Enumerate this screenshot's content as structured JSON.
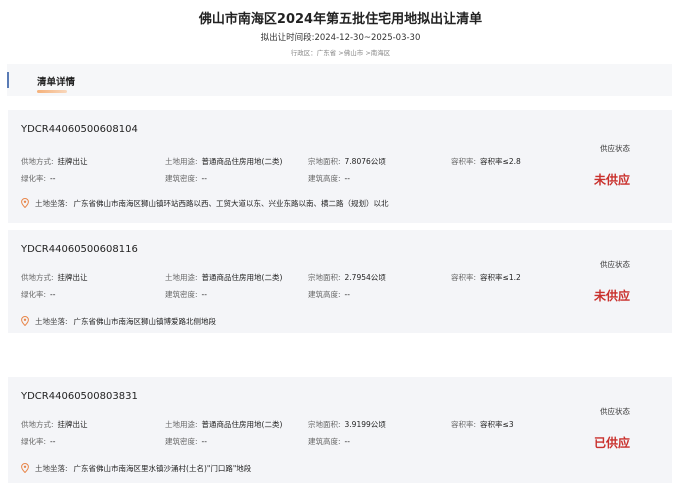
{
  "header": {
    "title": "佛山市南海区2024年第五批住宅用地拟出让清单",
    "period": "拟出让时间段:2024-12-30~2025-03-30",
    "region": "行政区：广东省 >佛山市 >南海区"
  },
  "section": {
    "title": "清单详情"
  },
  "labels": {
    "supply_method": "供地方式:",
    "land_use": "土地用途:",
    "area": "宗地面积:",
    "plot_ratio": "容积率:",
    "greening": "绿化率:",
    "density": "建筑密度:",
    "height": "建筑高度:",
    "location": "土地坐落:",
    "supply_state": "供应状态"
  },
  "cards": [
    {
      "code": "YDCR44060500608104",
      "supply_method": "挂牌出让",
      "land_use": "普通商品住房用地(二类)",
      "area": "7.8076公顷",
      "plot_ratio": "容积率≤2.8",
      "greening": "--",
      "density": "--",
      "height": "--",
      "location": "广东省佛山市南海区狮山镇环站西路以西、工贸大道以东、兴业东路以南、横二路（规划）以北",
      "status": "未供应",
      "status_color": "#c9302c"
    },
    {
      "code": "YDCR44060500608116",
      "supply_method": "挂牌出让",
      "land_use": "普通商品住房用地(二类)",
      "area": "2.7954公顷",
      "plot_ratio": "容积率≤1.2",
      "greening": "--",
      "density": "--",
      "height": "--",
      "location": "广东省佛山市南海区狮山镇博爱路北侧地段",
      "status": "未供应",
      "status_color": "#c9302c"
    },
    {
      "code": "YDCR44060500803831",
      "supply_method": "挂牌出让",
      "land_use": "普通商品住房用地(二类)",
      "area": "3.9199公顷",
      "plot_ratio": "容积率≤3",
      "greening": "--",
      "density": "--",
      "height": "--",
      "location": "广东省佛山市南海区里水镇沙涌村(土名)\"门口路\"地段",
      "status": "已供应",
      "status_color": "#c9302c"
    }
  ],
  "icons": {
    "pin": "location-pin-icon"
  },
  "colors": {
    "pin": "#e8864a",
    "status": "#c9302c",
    "card_bg": "#f4f5f8"
  }
}
